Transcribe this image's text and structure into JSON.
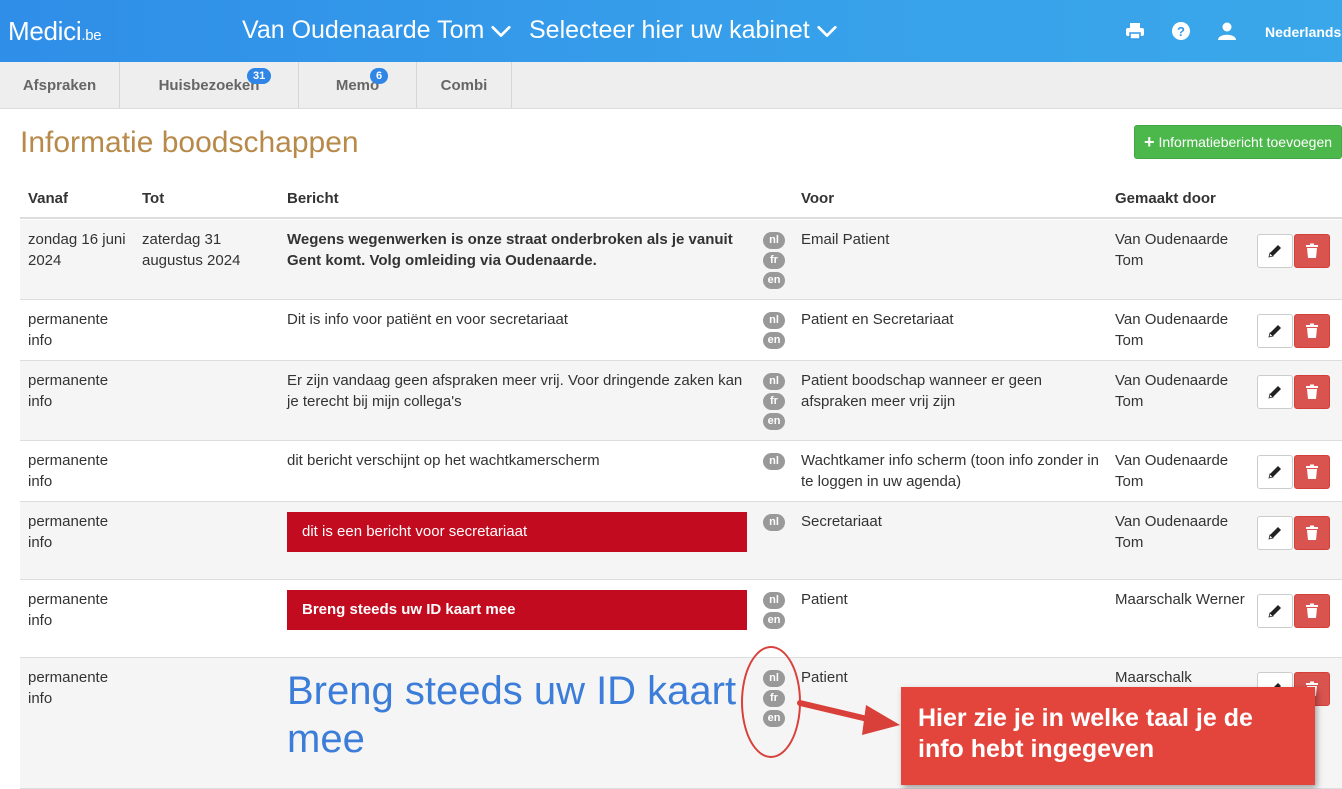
{
  "header": {
    "brand": "Medici",
    "brand_tld": ".be",
    "doctor": "Van Oudenaarde Tom",
    "cabinet": "Selecteer hier uw kabinet",
    "language": "Nederlands"
  },
  "tabs": [
    {
      "label": "Afspraken",
      "badge": ""
    },
    {
      "label": "Huisbezoeken",
      "badge": "31"
    },
    {
      "label": "Memo",
      "badge": "6"
    },
    {
      "label": "Combi",
      "badge": ""
    }
  ],
  "page": {
    "title": "Informatie boodschappen",
    "add_button": "Informatiebericht toevoegen"
  },
  "table": {
    "headers": {
      "vanaf": "Vanaf",
      "tot": "Tot",
      "bericht": "Bericht",
      "voor": "Voor",
      "gemaakt_door": "Gemaakt door"
    },
    "rows": [
      {
        "vanaf": "zondag 16 juni 2024",
        "tot": "zaterdag 31 augustus 2024",
        "bericht": "Wegens wegenwerken is onze straat onderbroken als je vanuit Gent komt. Volg omleiding via Oudenaarde.",
        "style": "bold",
        "langs": [
          "nl",
          "fr",
          "en"
        ],
        "voor": "Email Patient",
        "gemaakt_door": "Van Oudenaarde Tom"
      },
      {
        "vanaf": "permanente info",
        "tot": "",
        "bericht": "Dit is info voor patiënt en voor secretariaat",
        "style": "normal",
        "langs": [
          "nl",
          "en"
        ],
        "voor": "Patient en Secretariaat",
        "gemaakt_door": "Van Oudenaarde Tom"
      },
      {
        "vanaf": "permanente info",
        "tot": "",
        "bericht": "Er zijn vandaag geen afspraken meer vrij. Voor dringende zaken kan je terecht bij mijn collega's",
        "style": "normal",
        "langs": [
          "nl",
          "fr",
          "en"
        ],
        "voor": "Patient boodschap wanneer er geen afspraken meer vrij zijn",
        "gemaakt_door": "Van Oudenaarde Tom"
      },
      {
        "vanaf": "permanente info",
        "tot": "",
        "bericht": "dit bericht verschijnt op het wachtkamerscherm",
        "style": "normal",
        "langs": [
          "nl"
        ],
        "voor": "Wachtkamer info scherm (toon info zonder in te loggen in uw agenda)",
        "gemaakt_door": "Van Oudenaarde Tom"
      },
      {
        "vanaf": "permanente info",
        "tot": "",
        "bericht": "dit is een bericht voor secretariaat",
        "style": "red",
        "langs": [
          "nl"
        ],
        "voor": "Secretariaat",
        "gemaakt_door": "Van Oudenaarde Tom"
      },
      {
        "vanaf": "permanente info",
        "tot": "",
        "bericht": "Breng steeds uw ID kaart mee",
        "style": "red-bold",
        "langs": [
          "nl",
          "en"
        ],
        "voor": "Patient",
        "gemaakt_door": "Maarschalk Werner"
      },
      {
        "vanaf": "permanente info",
        "tot": "",
        "bericht": "Breng steeds uw ID kaart mee",
        "style": "big",
        "langs": [
          "nl",
          "fr",
          "en"
        ],
        "voor": "Patient",
        "gemaakt_door": "Maarschalk"
      }
    ]
  },
  "annotation": {
    "text": "Hier zie je in welke taal je de info hebt ingegeven"
  },
  "colors": {
    "header_blue": "#2f8ee8",
    "title_gold": "#b78a4a",
    "add_green": "#4cb84c",
    "alert_red": "#c30b1f",
    "delete_red": "#d9534f",
    "annotation_red": "#e3443b"
  }
}
